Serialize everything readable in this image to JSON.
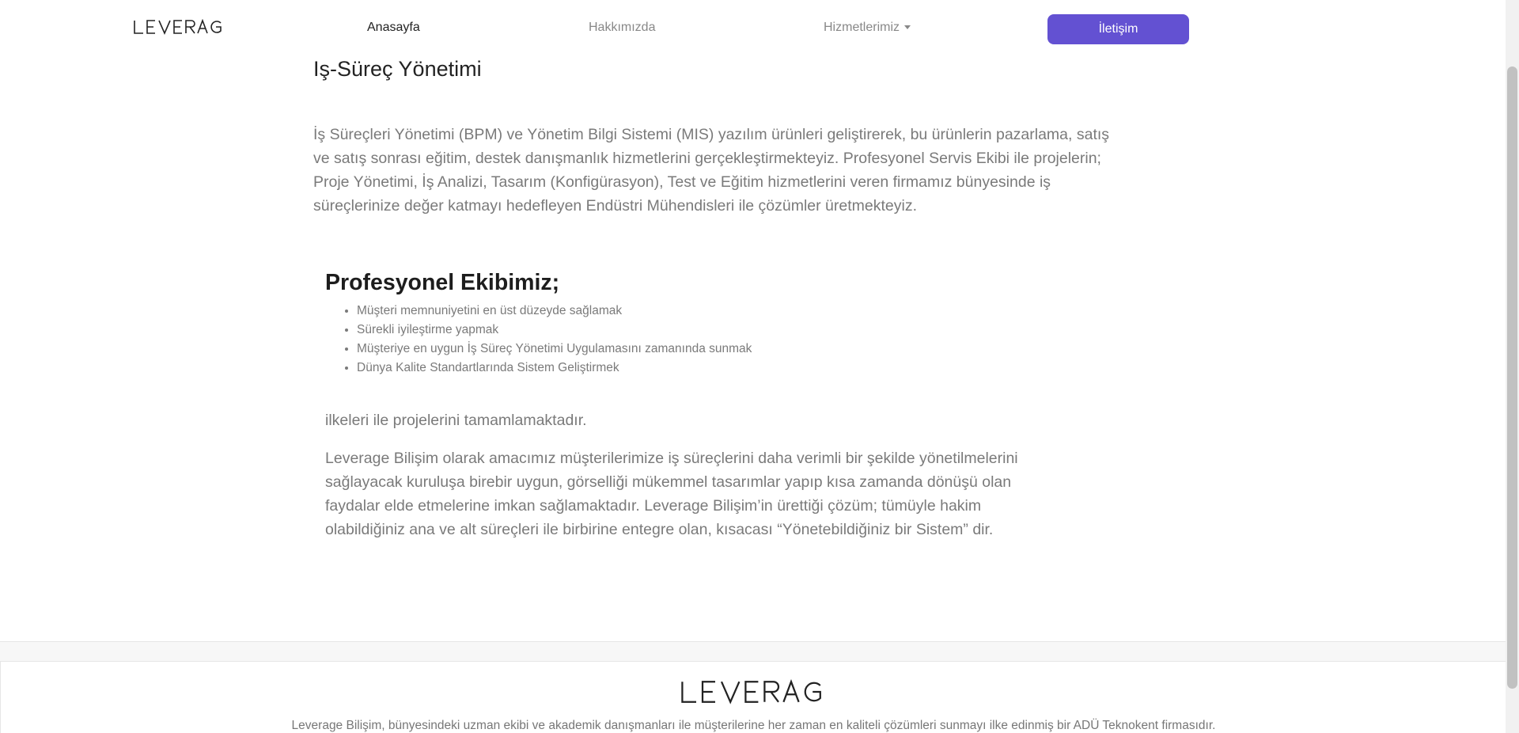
{
  "nav": {
    "brand": "LEVERAGE",
    "home": "Anasayfa",
    "about": "Hakkımızda",
    "services": "Hizmetlerimiz",
    "contact": "İletişim"
  },
  "page": {
    "title": "Iş-Süreç Yönetimi",
    "intro": "İş Süreçleri Yönetimi (BPM) ve Yönetim Bilgi Sistemi (MIS) yazılım ürünleri geliştirerek, bu ürünlerin pazarlama, satış ve satış sonrası eğitim, destek danışmanlık hizmetlerini gerçekleştirmekteyiz. Profesyonel Servis Ekibi ile projelerin; Proje Yönetimi, İş Analizi, Tasarım (Konfigürasyon), Test ve Eğitim hizmetlerini veren firmamız bünyesinde iş süreçlerinize değer katmayı hedefleyen Endüstri Mühendisleri ile çözümler üretmekteyiz.",
    "team_title": "Profesyonel Ekibimiz;",
    "team_items": [
      "Müşteri memnuniyetini en üst düzeyde sağlamak",
      "Sürekli iyileştirme yapmak",
      "Müşteriye en uygun İş Süreç Yönetimi Uygulamasını zamanında sunmak",
      "Dünya Kalite Standartlarında Sistem Geliştirmek"
    ],
    "principles": "ilkeleri ile projelerini tamamlamaktadır.",
    "mission": "Leverage Bilişim olarak amacımız müşterilerimize iş süreçlerini daha verimli bir şekilde yönetilmelerini sağlayacak kuruluşa birebir uygun, görselliği mükemmel tasarımlar yapıp kısa zamanda dönüşü olan faydalar elde etmelerine imkan sağlamaktadır. Leverage Bilişim’in ürettiği çözüm; tümüyle hakim olabildiğiniz ana ve alt süreçleri ile birbirine entegre olan, kısacası “Yönetebildiğiniz bir Sistem” dir."
  },
  "footer": {
    "brand": "LEVERAGE",
    "text": "Leverage Bilişim, bünyesindeki uzman ekibi ve akademik danışmanları ile müşterilerine her zaman en kaliteli çözümleri sunmayı ilke edinmiş bir ADÜ Teknokent firmasıdır."
  },
  "colors": {
    "accent": "#6351d2"
  }
}
